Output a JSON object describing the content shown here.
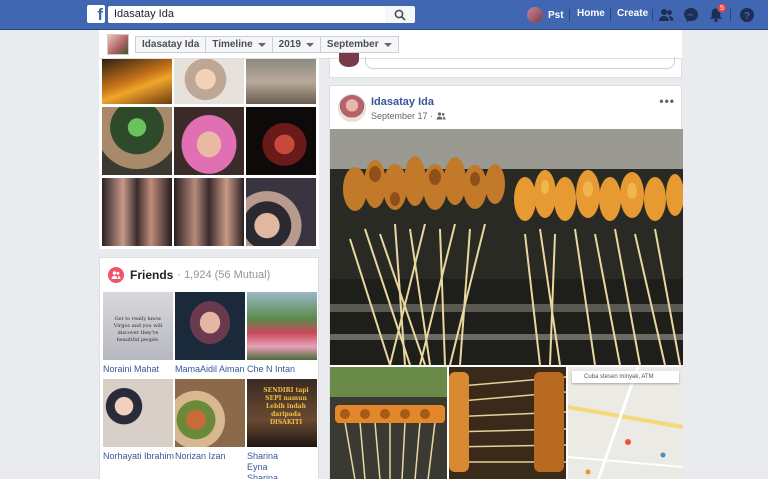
{
  "topbar": {
    "search_value": "Idasatay Ida",
    "user_name": "Pst",
    "home_label": "Home",
    "create_label": "Create",
    "notification_count": "5",
    "brand_color": "#4267b2"
  },
  "profile_header": {
    "name_crumb": "Idasatay Ida",
    "timeline_crumb": "Timeline",
    "year_crumb": "2019",
    "month_crumb": "September"
  },
  "friends": {
    "title": "Friends",
    "count": "· 1,924 (56 Mutual)",
    "items": [
      {
        "name": "Noraini Mahat",
        "tile_text": "Get to really know Virgos and you will discover they're beautiful people."
      },
      {
        "name": "MamaAidil Aiman"
      },
      {
        "name": "Che N Intan"
      },
      {
        "name": "Norhayati Ibrahim"
      },
      {
        "name": "Norizan Izan"
      },
      {
        "name": "Sharina Eyna Sharina Eyna",
        "tile_text": "SENDIRI tapi SEPI namun Lebih indah daripada DISAKITI"
      }
    ]
  },
  "post": {
    "author": "Idasatay Ida",
    "date": "September 17 ·",
    "menu": "•••",
    "map_search_placeholder": "Cuba stesen minyak, ATM"
  },
  "icons": {
    "search": "search-icon",
    "friends_requests": "friend-requests-icon",
    "messenger": "messenger-icon",
    "notifications": "bell-icon",
    "help": "help-icon",
    "audience": "friends-audience-icon"
  }
}
